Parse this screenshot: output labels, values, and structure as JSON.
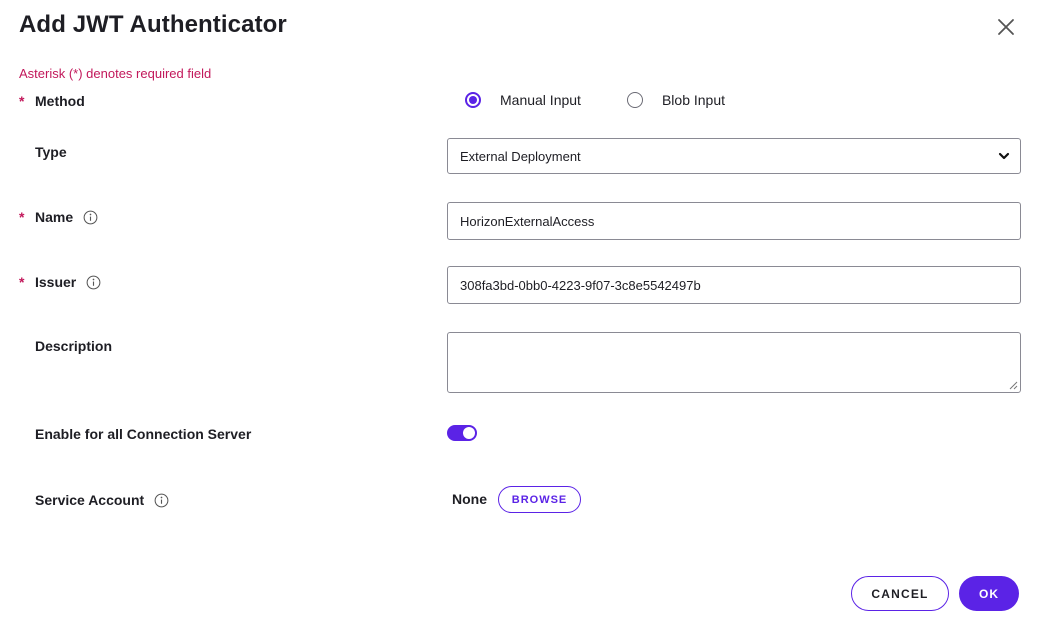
{
  "dialog": {
    "title": "Add JWT Authenticator",
    "required_note": "Asterisk (*) denotes required field",
    "close_icon": "close-icon"
  },
  "form": {
    "method": {
      "label": "Method",
      "required": true,
      "options": [
        {
          "label": "Manual Input",
          "selected": true
        },
        {
          "label": "Blob Input",
          "selected": false
        }
      ]
    },
    "type": {
      "label": "Type",
      "selected": "External Deployment"
    },
    "name": {
      "label": "Name",
      "required": true,
      "value": "HorizonExternalAccess"
    },
    "issuer": {
      "label": "Issuer",
      "required": true,
      "value": "308fa3bd-0bb0-4223-9f07-3c8e5542497b"
    },
    "description": {
      "label": "Description",
      "value": ""
    },
    "enable_all": {
      "label": "Enable for all Connection Server",
      "enabled": true
    },
    "service_account": {
      "label": "Service Account",
      "value": "None",
      "browse_label": "BROWSE"
    }
  },
  "footer": {
    "cancel_label": "CANCEL",
    "ok_label": "OK"
  },
  "colors": {
    "accent": "#5b23e6",
    "required": "#c2185b"
  }
}
